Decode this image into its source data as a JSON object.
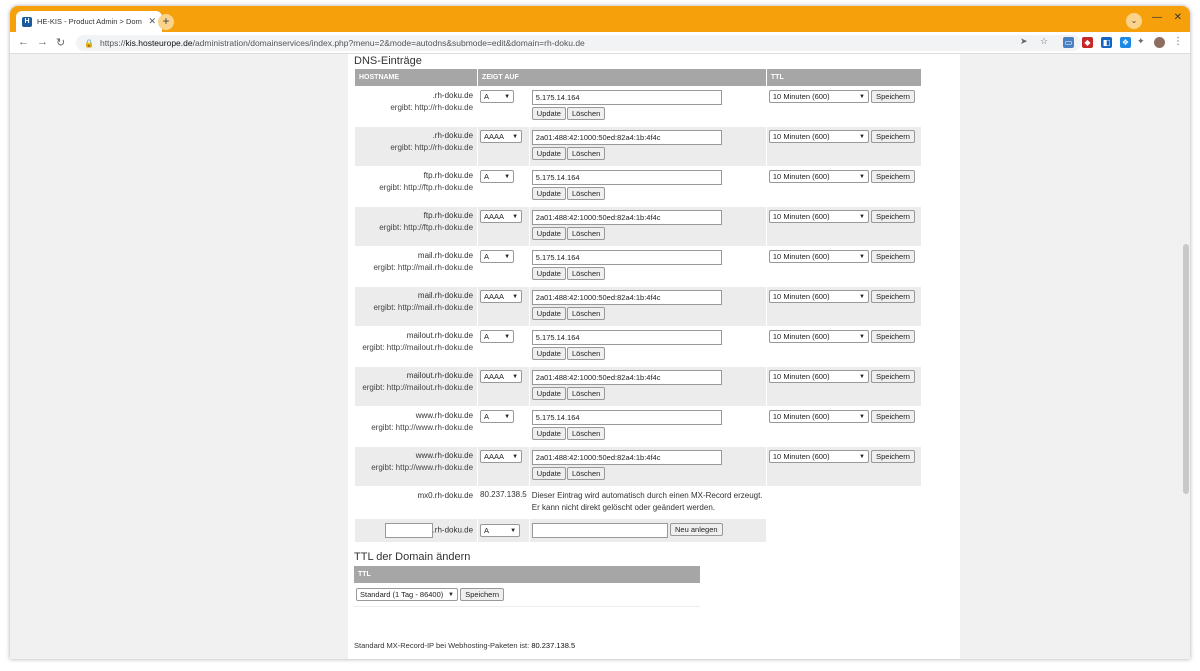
{
  "browser": {
    "tab_title": "HE-KIS - Product Admin > Dom",
    "favicon_letter": "H",
    "new_tab_label": "+",
    "url_prefix": "https://",
    "url_host": "kis.hosteurope.de",
    "url_path": "/administration/domainservices/index.php?menu=2&mode=autodns&submode=edit&domain=rh-doku.de",
    "accent_color": "#f6a00b"
  },
  "dns": {
    "section_title": "DNS-Einträge",
    "columns": [
      "HOSTNAME",
      "ZEIGT AUF",
      "TTL"
    ],
    "update_label": "Update",
    "delete_label": "Löschen",
    "save_label": "Speichern",
    "records": [
      {
        "host": ".rh-doku.de",
        "resolves": "ergibt: http://rh-doku.de",
        "type": "A",
        "value": "5.175.14.164",
        "ttl": "10 Minuten (600)"
      },
      {
        "host": ".rh-doku.de",
        "resolves": "ergibt: http://rh-doku.de",
        "type": "AAAA",
        "value": "2a01:488:42:1000:50ed:82a4:1b:4f4c",
        "ttl": "10 Minuten (600)"
      },
      {
        "host": "ftp.rh-doku.de",
        "resolves": "ergibt: http://ftp.rh-doku.de",
        "type": "A",
        "value": "5.175.14.164",
        "ttl": "10 Minuten (600)"
      },
      {
        "host": "ftp.rh-doku.de",
        "resolves": "ergibt: http://ftp.rh-doku.de",
        "type": "AAAA",
        "value": "2a01:488:42:1000:50ed:82a4:1b:4f4c",
        "ttl": "10 Minuten (600)"
      },
      {
        "host": "mail.rh-doku.de",
        "resolves": "ergibt: http://mail.rh-doku.de",
        "type": "A",
        "value": "5.175.14.164",
        "ttl": "10 Minuten (600)"
      },
      {
        "host": "mail.rh-doku.de",
        "resolves": "ergibt: http://mail.rh-doku.de",
        "type": "AAAA",
        "value": "2a01:488:42:1000:50ed:82a4:1b:4f4c",
        "ttl": "10 Minuten (600)"
      },
      {
        "host": "mailout.rh-doku.de",
        "resolves": "ergibt: http://mailout.rh-doku.de",
        "type": "A",
        "value": "5.175.14.164",
        "ttl": "10 Minuten (600)"
      },
      {
        "host": "mailout.rh-doku.de",
        "resolves": "ergibt: http://mailout.rh-doku.de",
        "type": "AAAA",
        "value": "2a01:488:42:1000:50ed:82a4:1b:4f4c",
        "ttl": "10 Minuten (600)"
      },
      {
        "host": "www.rh-doku.de",
        "resolves": "ergibt: http://www.rh-doku.de",
        "type": "A",
        "value": "5.175.14.164",
        "ttl": "10 Minuten (600)"
      },
      {
        "host": "www.rh-doku.de",
        "resolves": "ergibt: http://www.rh-doku.de",
        "type": "AAAA",
        "value": "2a01:488:42:1000:50ed:82a4:1b:4f4c",
        "ttl": "10 Minuten (600)"
      }
    ],
    "mx": {
      "host": "mx0.rh-doku.de",
      "value": "80.237.138.5",
      "note_line1": "Dieser Eintrag wird automatisch durch einen MX-Record erzeugt.",
      "note_line2": "Er kann nicht direkt gelöscht oder geändert werden."
    },
    "new_entry": {
      "host_suffix": ".rh-doku.de",
      "type": "A",
      "create_label": "Neu anlegen"
    }
  },
  "domain_ttl": {
    "section_title": "TTL der Domain ändern",
    "column": "TTL",
    "selected": "Standard (1 Tag - 86400)",
    "save_label": "Speichern"
  },
  "footer": {
    "mx_label": "Standard MX-Record-IP bei Webhosting-Paketen ist:",
    "mx_ip": "80.237.138.5"
  }
}
